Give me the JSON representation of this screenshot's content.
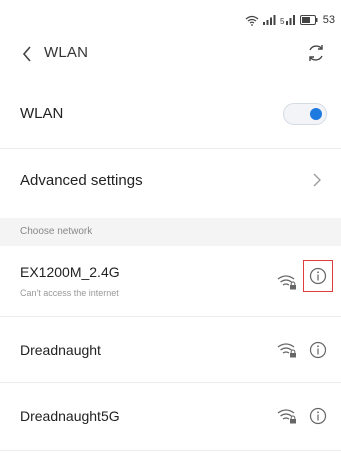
{
  "status_bar": {
    "battery_level": "53"
  },
  "header": {
    "title": "WLAN",
    "back_icon": "chevron-left-icon",
    "refresh_icon": "refresh-icon"
  },
  "wlan_toggle_row": {
    "label": "WLAN",
    "enabled": true
  },
  "advanced_row": {
    "label": "Advanced settings"
  },
  "section": {
    "label": "Choose network"
  },
  "networks": [
    {
      "name": "EX1200M_2.4G",
      "status": "Can't access the internet",
      "secured": true,
      "info_highlighted": true
    },
    {
      "name": "Dreadnaught",
      "status": "",
      "secured": true,
      "info_highlighted": false
    },
    {
      "name": "Dreadnaught5G",
      "status": "",
      "secured": true,
      "info_highlighted": false
    }
  ],
  "colors": {
    "accent": "#1f7ae0",
    "highlight": "#e23b3b",
    "section_bg": "#f4f4f4"
  }
}
